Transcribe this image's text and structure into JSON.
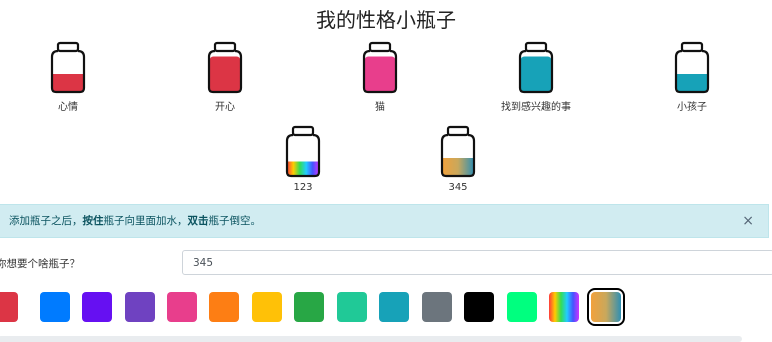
{
  "title": "我的性格小瓶子",
  "bottles": [
    {
      "label": "心情",
      "fill_color": "#dc3545",
      "fill_level": 0.5
    },
    {
      "label": "开心",
      "fill_color": "#dc3545",
      "fill_level": 1.0
    },
    {
      "label": "猫",
      "fill_color": "#e83e8c",
      "fill_level": 1.0
    },
    {
      "label": "找到感兴趣的事",
      "fill_color": "#17a2b8",
      "fill_level": 1.0
    },
    {
      "label": "小孩子",
      "fill_color": "#17a2b8",
      "fill_level": 0.5
    },
    {
      "label": "123",
      "fill_color": "rainbow",
      "fill_level": 0.4
    },
    {
      "label": "345",
      "fill_color": "sunset",
      "fill_level": 0.5
    }
  ],
  "alert": {
    "text_before": "添加瓶子之后，",
    "bold1": "按住",
    "text_mid": "瓶子向里面加水，",
    "bold2": "双击",
    "text_after": "瓶子倒空。",
    "close": "×"
  },
  "form": {
    "question": "你想要个啥瓶子？",
    "name_value": "345"
  },
  "palette": [
    "#dc3545",
    "#007bff",
    "#6610f2",
    "#6f42c1",
    "#e83e8c",
    "#fd7e14",
    "#ffc107",
    "#28a745",
    "#20c997",
    "#17a2b8",
    "#6c757d",
    "#000000",
    "#00ff7f",
    "rainbow",
    "sunset"
  ],
  "selected_swatch": 14
}
